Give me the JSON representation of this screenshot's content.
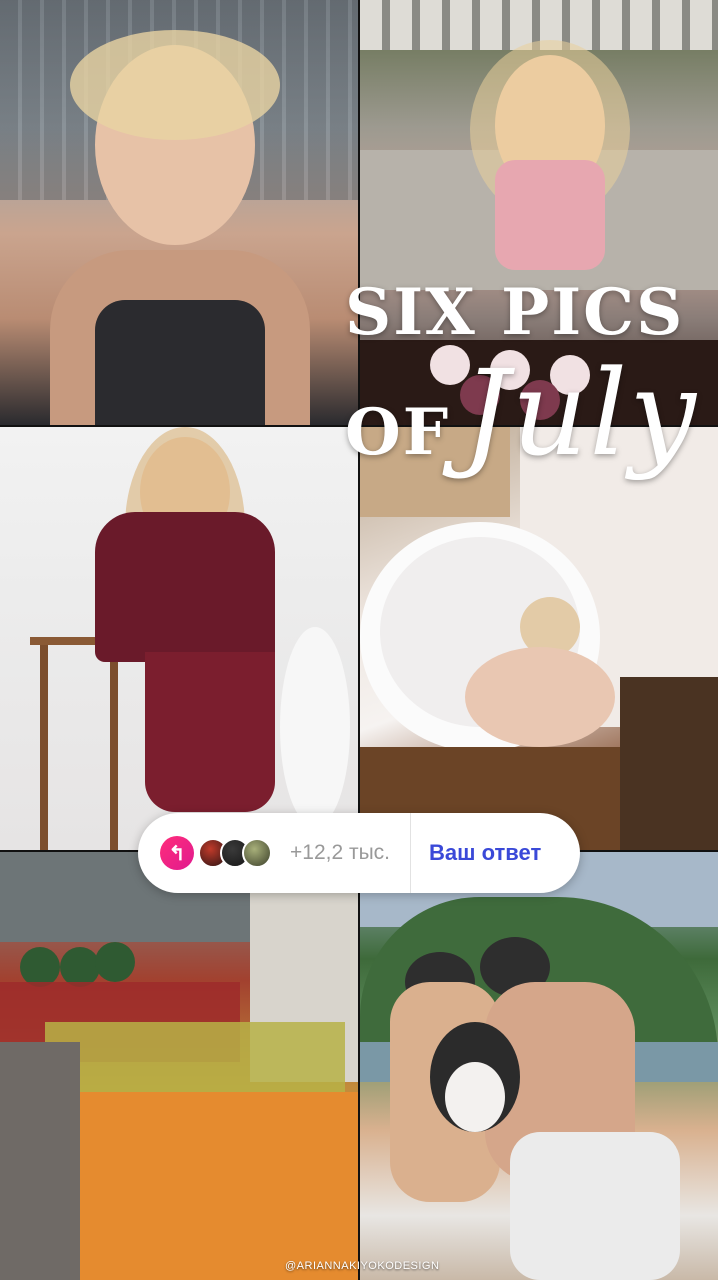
{
  "story": {
    "title_line1": "SIX PICS",
    "title_line2_small": "OF",
    "title_line2_big": "July",
    "credit": "@ARIANNAKIYOKODESIGN"
  },
  "reply": {
    "icon": "reply-arrow-icon",
    "responder_count": "+12,2 тыс.",
    "answer_label": "Ваш ответ"
  },
  "colors": {
    "reply_icon": "#ff2d7a",
    "answer_text": "#3a49d8"
  }
}
